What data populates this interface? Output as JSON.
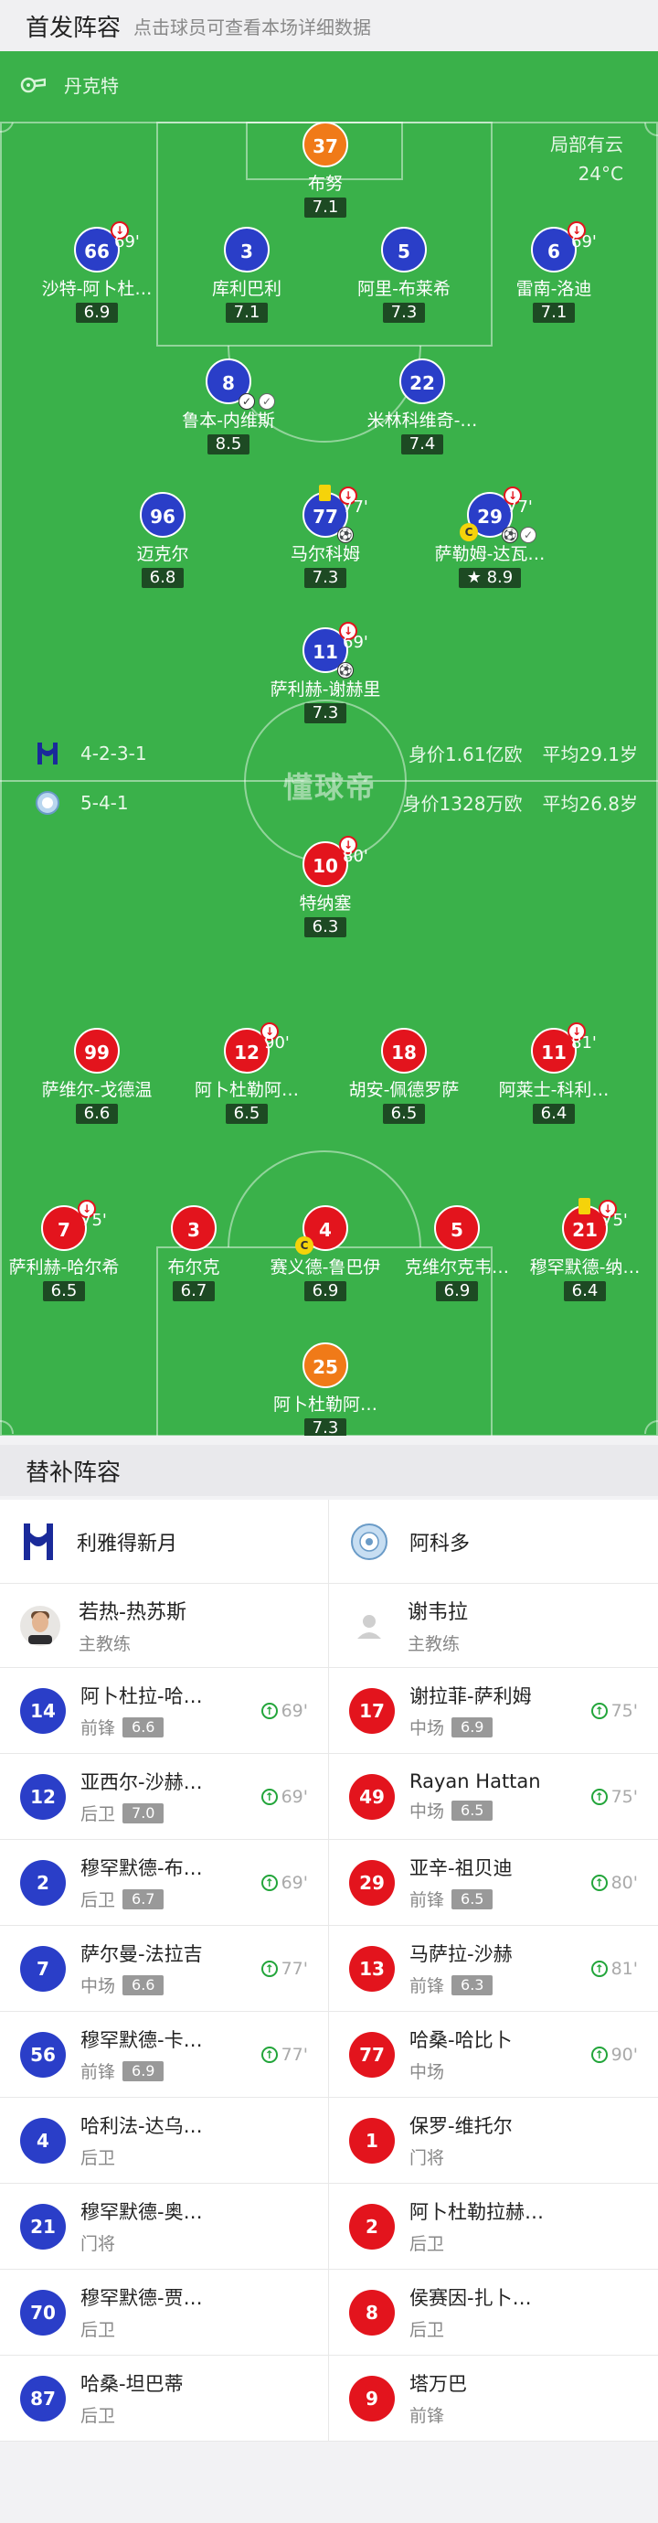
{
  "starting": {
    "title": "首发阵容",
    "subtitle": "点击球员可查看本场详细数据"
  },
  "venue": {
    "name": "丹克特",
    "weather": "局部有云",
    "temp": "24°C"
  },
  "watermark": "懂球帝",
  "home": {
    "formation": "4-2-3-1",
    "value": "身价1.61亿欧",
    "age": "平均29.1岁",
    "color": "#2a3ec8"
  },
  "away": {
    "formation": "5-4-1",
    "value": "身价1328万欧",
    "age": "平均26.8岁",
    "color": "#e3141d"
  },
  "home_players": [
    {
      "num": "37",
      "name": "布努",
      "rating": "7.1"
    },
    {
      "num": "66",
      "name": "沙特-阿卜杜…",
      "rating": "6.9",
      "sub": "69'"
    },
    {
      "num": "3",
      "name": "库利巴利",
      "rating": "7.1"
    },
    {
      "num": "5",
      "name": "阿里-布莱希",
      "rating": "7.3"
    },
    {
      "num": "6",
      "name": "雷南-洛迪",
      "rating": "7.1",
      "sub": "69'"
    },
    {
      "num": "8",
      "name": "鲁本-内维斯",
      "rating": "8.5"
    },
    {
      "num": "22",
      "name": "米林科维奇-…",
      "rating": "7.4"
    },
    {
      "num": "96",
      "name": "迈克尔",
      "rating": "6.8"
    },
    {
      "num": "77",
      "name": "马尔科姆",
      "rating": "7.3",
      "sub": "77'"
    },
    {
      "num": "29",
      "name": "萨勒姆-达瓦…",
      "rating": "8.9",
      "sub": "77'"
    },
    {
      "num": "11",
      "name": "萨利赫-谢赫里",
      "rating": "7.3",
      "sub": "69'"
    }
  ],
  "away_players": [
    {
      "num": "10",
      "name": "特纳塞",
      "rating": "6.3",
      "sub": "80'"
    },
    {
      "num": "99",
      "name": "萨维尔-戈德温",
      "rating": "6.6"
    },
    {
      "num": "12",
      "name": "阿卜杜勒阿…",
      "rating": "6.5",
      "sub": "90'"
    },
    {
      "num": "18",
      "name": "胡安-佩德罗萨",
      "rating": "6.5"
    },
    {
      "num": "11",
      "name": "阿莱士-科利…",
      "rating": "6.4",
      "sub": "81'"
    },
    {
      "num": "7",
      "name": "萨利赫-哈尔希",
      "rating": "6.5",
      "sub": "75'"
    },
    {
      "num": "3",
      "name": "布尔克",
      "rating": "6.7"
    },
    {
      "num": "4",
      "name": "赛义德-鲁巴伊",
      "rating": "6.9"
    },
    {
      "num": "5",
      "name": "克维尔克韦…",
      "rating": "6.9"
    },
    {
      "num": "21",
      "name": "穆罕默德-纳…",
      "rating": "6.4",
      "sub": "75'"
    },
    {
      "num": "25",
      "name": "阿卜杜勒阿…",
      "rating": "7.3"
    }
  ],
  "bench": {
    "title": "替补阵容",
    "home_team": "利雅得新月",
    "away_team": "阿科多",
    "home_coach": {
      "name": "若热-热苏斯",
      "role": "主教练"
    },
    "away_coach": {
      "name": "谢韦拉",
      "role": "主教练"
    },
    "home": [
      {
        "num": "14",
        "name": "阿卜杜拉-哈…",
        "pos": "前锋",
        "rating": "6.6",
        "sub": "69'"
      },
      {
        "num": "12",
        "name": "亚西尔-沙赫…",
        "pos": "后卫",
        "rating": "7.0",
        "sub": "69'"
      },
      {
        "num": "2",
        "name": "穆罕默德-布…",
        "pos": "后卫",
        "rating": "6.7",
        "sub": "69'"
      },
      {
        "num": "7",
        "name": "萨尔曼-法拉吉",
        "pos": "中场",
        "rating": "6.6",
        "sub": "77'"
      },
      {
        "num": "56",
        "name": "穆罕默德-卡…",
        "pos": "前锋",
        "rating": "6.9",
        "sub": "77'"
      },
      {
        "num": "4",
        "name": "哈利法-达乌…",
        "pos": "后卫",
        "rating": "",
        "sub": ""
      },
      {
        "num": "21",
        "name": "穆罕默德-奥…",
        "pos": "门将",
        "rating": "",
        "sub": ""
      },
      {
        "num": "70",
        "name": "穆罕默德-贾…",
        "pos": "后卫",
        "rating": "",
        "sub": ""
      },
      {
        "num": "87",
        "name": "哈桑-坦巴蒂",
        "pos": "后卫",
        "rating": "",
        "sub": ""
      }
    ],
    "away": [
      {
        "num": "17",
        "name": "谢拉菲-萨利姆",
        "pos": "中场",
        "rating": "6.9",
        "sub": "75'"
      },
      {
        "num": "49",
        "name": "Rayan Hattan",
        "pos": "中场",
        "rating": "6.5",
        "sub": "75'"
      },
      {
        "num": "29",
        "name": "亚辛-祖贝迪",
        "pos": "前锋",
        "rating": "6.5",
        "sub": "80'"
      },
      {
        "num": "13",
        "name": "马萨拉-沙赫",
        "pos": "前锋",
        "rating": "6.3",
        "sub": "81'"
      },
      {
        "num": "77",
        "name": "哈桑-哈比卜",
        "pos": "中场",
        "rating": "",
        "sub": "90'"
      },
      {
        "num": "1",
        "name": "保罗-维托尔",
        "pos": "门将",
        "rating": "",
        "sub": ""
      },
      {
        "num": "2",
        "name": "阿卜杜勒拉赫…",
        "pos": "后卫",
        "rating": "",
        "sub": ""
      },
      {
        "num": "8",
        "name": "侯赛因-扎卜…",
        "pos": "后卫",
        "rating": "",
        "sub": ""
      },
      {
        "num": "9",
        "name": "塔万巴",
        "pos": "前锋",
        "rating": "",
        "sub": ""
      }
    ]
  }
}
